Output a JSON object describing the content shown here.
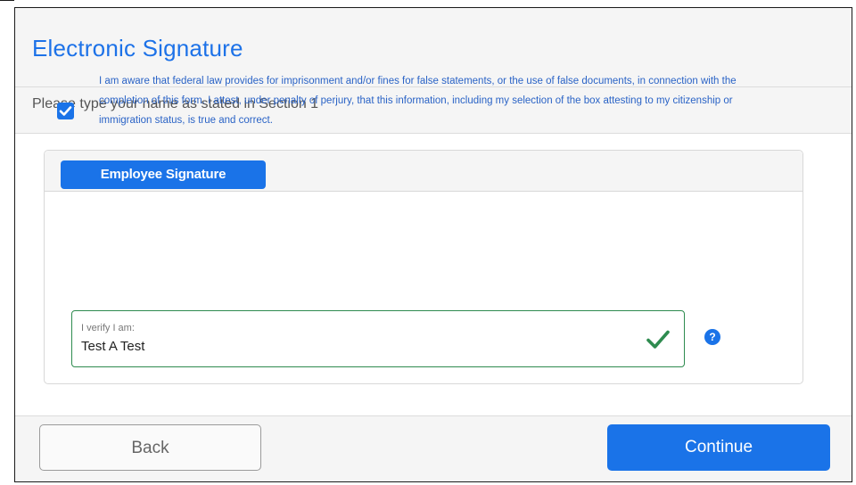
{
  "header": {
    "title": "Electronic Signature",
    "subtitle": "Please type your name as stated in Section 1"
  },
  "card": {
    "tab_label": "Employee Signature",
    "attestation_checked": true,
    "attestation_text": "I am aware that federal law provides for imprisonment and/or fines for false statements, or the use of false documents, in connection with the completion of this form. I attest, under penalty of perjury, that this information, including my selection of the box attesting to my citizenship or immigration status, is true and correct.",
    "verify_label": "I verify I am:",
    "verify_value": "Test A Test",
    "help_glyph": "?",
    "verify_status_icon": "check-icon"
  },
  "footer": {
    "back_label": "Back",
    "continue_label": "Continue"
  },
  "colors": {
    "accent": "#1a73e8",
    "success": "#2e8b4f",
    "attest_text": "#2a63c6"
  }
}
